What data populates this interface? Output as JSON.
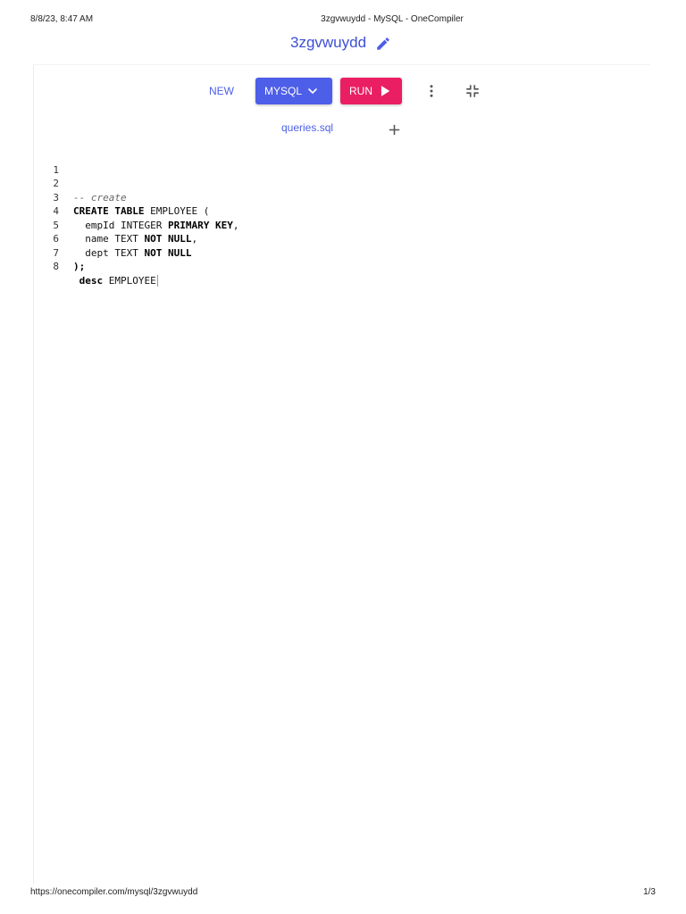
{
  "print_header": {
    "datetime": "8/8/23, 8:47 AM",
    "title": "3zgvwuydd - MySQL - OneCompiler"
  },
  "print_footer": {
    "url": "https://onecompiler.com/mysql/3zgvwuydd",
    "page": "1/3"
  },
  "project": {
    "title": "3zgvwuydd",
    "edit_icon": "pencil-icon"
  },
  "toolbar": {
    "new_label": "NEW",
    "language_label": "MYSQL",
    "run_label": "RUN",
    "more_icon": "more-vertical-icon",
    "collapse_icon": "collapse-icon",
    "accent_color": "#4d5ee8",
    "run_color": "#ea1e63"
  },
  "tabs": {
    "active_file": "queries.sql",
    "add_icon": "plus-icon"
  },
  "editor": {
    "lines": [
      {
        "n": "1",
        "text": ""
      },
      {
        "n": "2",
        "text": "-- create"
      },
      {
        "n": "3",
        "kw1": "CREATE TABLE",
        "rest": " EMPLOYEE ("
      },
      {
        "n": "4",
        "pre": "  empId INTEGER ",
        "kw": "PRIMARY KEY",
        "post": ","
      },
      {
        "n": "5",
        "pre": "  name TEXT ",
        "kw": "NOT NULL",
        "post": ","
      },
      {
        "n": "6",
        "pre": "  dept TEXT ",
        "kw": "NOT NULL",
        "post": ""
      },
      {
        "n": "7",
        "text": ");"
      },
      {
        "n": "8",
        "kw": " desc",
        "rest": " EMPLOYEE"
      }
    ]
  }
}
